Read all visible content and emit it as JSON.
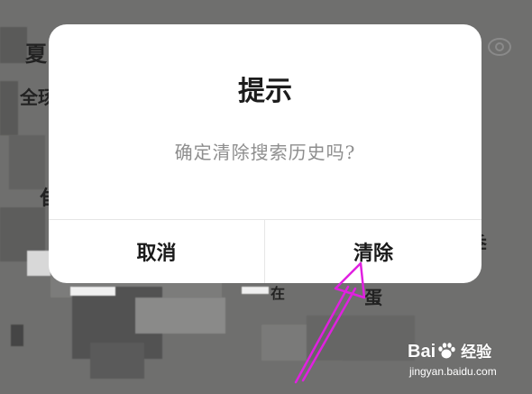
{
  "dialog": {
    "title": "提示",
    "message": "确定清除搜索历史吗?",
    "cancel_label": "取消",
    "confirm_label": "清除"
  },
  "background": {
    "fragments": [
      "夏",
      "全玚",
      "隹",
      "季",
      "蛋",
      "在"
    ]
  },
  "watermark": {
    "brand_a": "Bai",
    "brand_b": "经验",
    "url": "jingyan.baidu.com"
  },
  "colors": {
    "overlay": "#6f6f6e",
    "dialog_bg": "#ffffff",
    "message_text": "#8e8e8e",
    "annotation_arrow": "#e020e0"
  }
}
